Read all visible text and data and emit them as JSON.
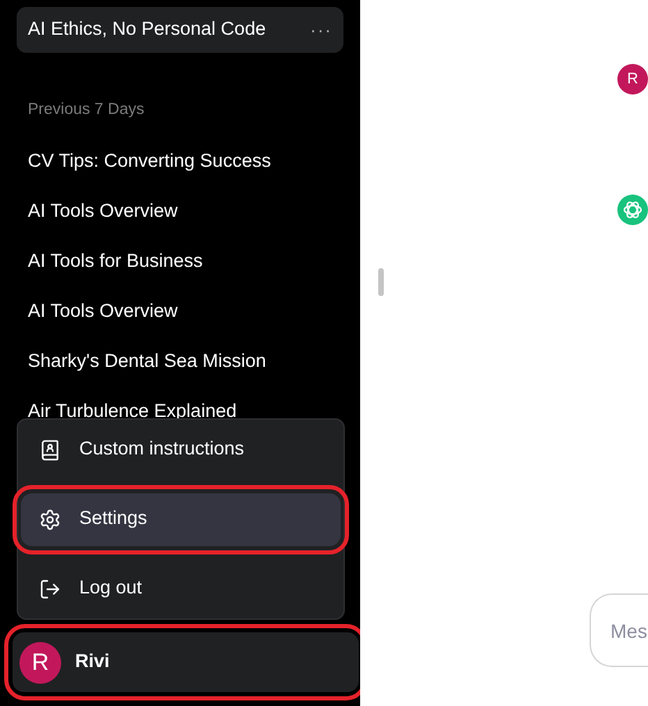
{
  "sidebar": {
    "active_chat": {
      "title": "AI Ethics, No Personal Code",
      "menu": "···"
    },
    "section": "Previous 7 Days",
    "chats": [
      {
        "title": "CV Tips: Converting Success"
      },
      {
        "title": "AI Tools Overview"
      },
      {
        "title": "AI Tools for Business"
      },
      {
        "title": "AI Tools Overview"
      },
      {
        "title": "Sharky's Dental Sea Mission"
      },
      {
        "title": "Air Turbulence Explained"
      }
    ]
  },
  "user_menu": {
    "items": [
      {
        "kind": "instructions",
        "label": "Custom instructions",
        "selected": false,
        "highlighted": false
      },
      {
        "kind": "settings",
        "label": "Settings",
        "selected": true,
        "highlighted": true
      },
      {
        "kind": "logout",
        "label": "Log out",
        "selected": false,
        "highlighted": false
      }
    ]
  },
  "user": {
    "initial": "R",
    "name": "Rivi",
    "highlighted": true
  },
  "chat": {
    "user_initial": "R",
    "input": {
      "placeholder": "Mes"
    }
  }
}
